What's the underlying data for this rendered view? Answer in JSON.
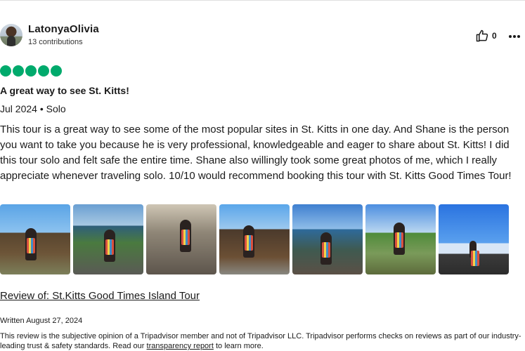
{
  "user": {
    "name": "LatonyaOlivia",
    "contributions": "13 contributions"
  },
  "actions": {
    "helpful_count": "0",
    "helpful_icon": "thumbs-up-icon",
    "more_icon": "more-horizontal-icon"
  },
  "review": {
    "rating": 5,
    "rating_color": "#00aa6c",
    "title": "A great way to see St. Kitts!",
    "meta": "Jul 2024 • Solo",
    "text": "This tour is a great way to see some of the most popular sites in St. Kitts in one day. And Shane is the person you want to take you because he is very professional, knowledgeable and eager to share about St. Kitts! I did this tour solo and felt safe the entire time. Shane also willingly took some great photos of me, which I really appreciate whenever traveling solo. 10/10 would recommend booking this tour with St. Kitts Good Times Tour!",
    "photo_count": 7,
    "review_of": "Review of: St.Kitts Good Times Island Tour",
    "written_date": "Written August 27, 2024"
  },
  "disclaimer": {
    "prefix": "This review is the subjective opinion of a Tripadvisor member and not of Tripadvisor LLC. Tripadvisor performs checks on reviews as part of our industry-leading trust & safety standards. Read our ",
    "link": "transparency report",
    "suffix": " to learn more."
  }
}
